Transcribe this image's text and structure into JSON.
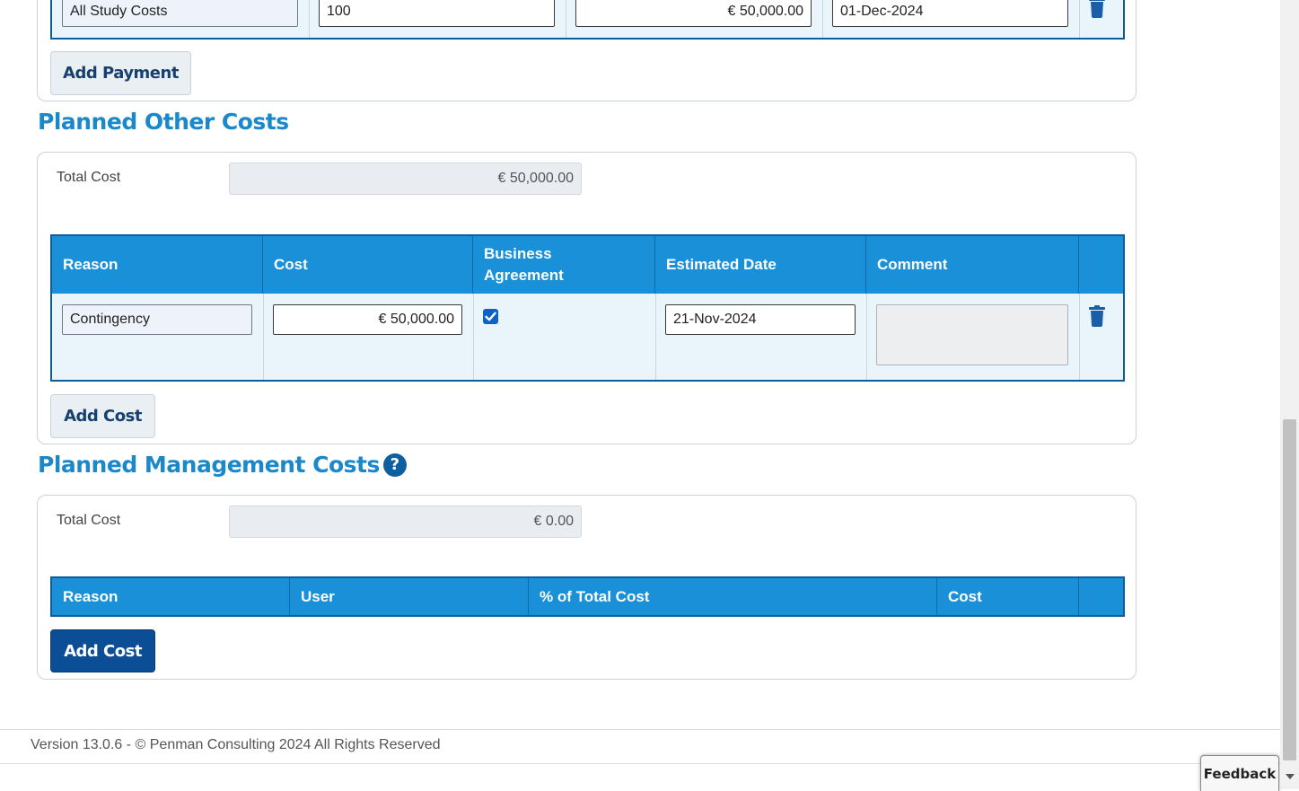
{
  "payments": {
    "row": {
      "reason": "All Study Costs",
      "percent": "100",
      "amount": "€ 50,000.00",
      "date": "01-Dec-2024"
    },
    "add_button": "Add Payment"
  },
  "other_costs": {
    "title": "Planned Other Costs",
    "total_label": "Total Cost",
    "total_value": "€ 50,000.00",
    "columns": [
      "Reason",
      "Cost",
      "Business Agreement",
      "Estimated Date",
      "Comment"
    ],
    "row": {
      "reason": "Contingency",
      "cost": "€ 50,000.00",
      "business_agreement": true,
      "estimated_date": "21-Nov-2024",
      "comment": ""
    },
    "add_button": "Add Cost"
  },
  "management_costs": {
    "title": "Planned Management Costs",
    "help_icon": "?",
    "total_label": "Total Cost",
    "total_value": "€ 0.00",
    "columns": [
      "Reason",
      "User",
      "% of Total Cost",
      "Cost"
    ],
    "add_button": "Add Cost"
  },
  "footer": {
    "text": "Version 13.0.6 - © Penman Consulting 2024 All Rights Reserved",
    "feedback": "Feedback"
  },
  "colors": {
    "section_title": "#1b88c9",
    "table_header": "#1990d8",
    "primary_button": "#0c4e96"
  }
}
